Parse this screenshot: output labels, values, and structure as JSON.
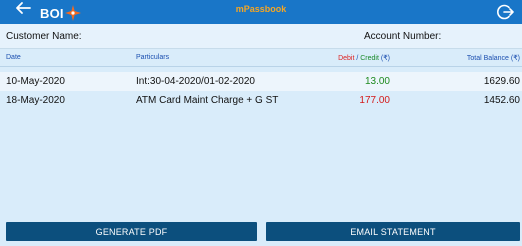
{
  "header": {
    "title": "mPassbook",
    "logo_text": "BOI",
    "back_icon": "back-arrow-icon",
    "logout_icon": "logout-icon"
  },
  "customer": {
    "name_label": "Customer Name:",
    "account_label": "Account Number:"
  },
  "table": {
    "columns": {
      "date": "Date",
      "particulars": "Particulars",
      "debit": "Debit",
      "separator": " / ",
      "credit": "Credit",
      "dc_unit": " (₹)",
      "balance": "Total Balance (₹)"
    },
    "rows": [
      {
        "date": "10-May-2020",
        "particulars": "Int:30-04-2020/01-02-2020",
        "amount": "13.00",
        "type": "credit",
        "balance": "1629.60"
      },
      {
        "date": "18-May-2020",
        "particulars": "ATM Card Maint Charge + G ST",
        "amount": "177.00",
        "type": "debit",
        "balance": "1452.60"
      }
    ]
  },
  "actions": {
    "generate_pdf": "GENERATE PDF",
    "email_statement": "EMAIL STATEMENT"
  },
  "colors": {
    "header_bg": "#1976c8",
    "title": "#f5a623",
    "credit": "#1e8a1e",
    "debit": "#d41a1a",
    "button_bg": "#0c4f7d",
    "page_bg": "#d9ecfa"
  }
}
